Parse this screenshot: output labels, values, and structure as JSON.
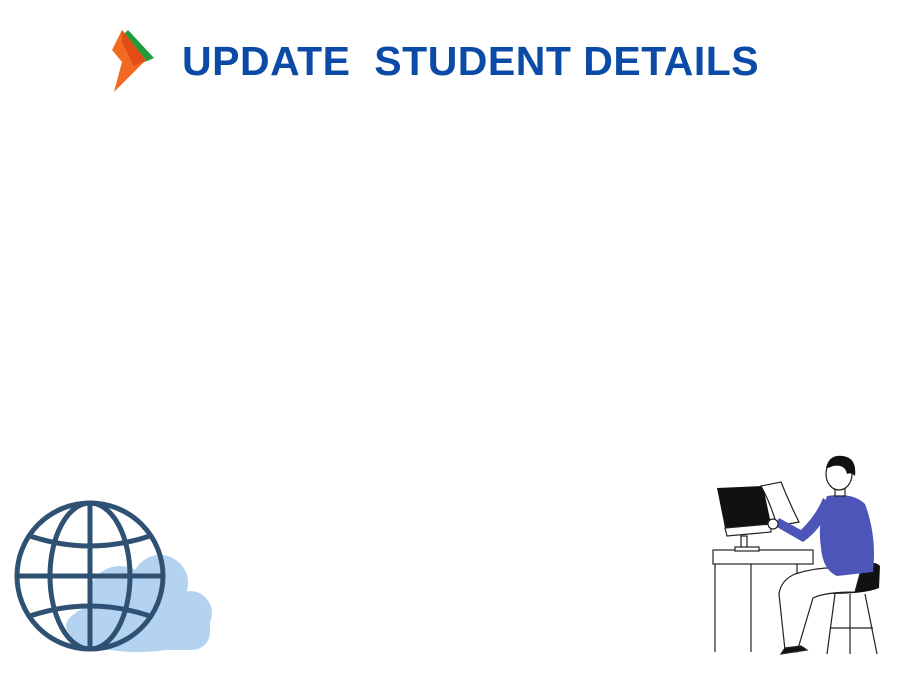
{
  "header": {
    "logo_icon": "bhim-upi-style-logo-icon",
    "title": "UPDATE  STUDENT DETAILS",
    "title_color": "#0b4aa6"
  },
  "illustrations": {
    "left": "globe-cloud-icon",
    "right": "person-at-computer-desk-icon"
  },
  "colors": {
    "logo_orange": "#f26a21",
    "logo_green": "#1f9d3a",
    "globe_stroke": "#2f5173",
    "cloud_fill": "#b3d3f0",
    "shirt": "#4e55b8"
  }
}
